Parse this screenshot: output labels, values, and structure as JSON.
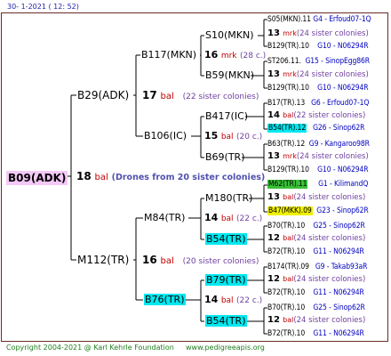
{
  "header": {
    "date": "30-   1-2021  ( 12:  52)"
  },
  "footer": {
    "copyright": "Copyright 2004-2021 @ Karl Kehrle Foundation",
    "site": "www.pedigreeapis.org"
  },
  "root": {
    "name": "B09(ADK)",
    "num": "18",
    "bal": "bal",
    "note": "(Drones from 20 sister colonies)"
  },
  "gen1": [
    {
      "name": "B29(ADK)",
      "num": "17",
      "bal": "bal",
      "note": "(22 sister colonies)"
    },
    {
      "name": "M112(TR)",
      "num": "16",
      "bal": "bal",
      "note": "(20 sister colonies)"
    }
  ],
  "gen2": [
    {
      "name": "B117(MKN)",
      "num": "16",
      "bal": "mrk",
      "note": "(28 c.)"
    },
    {
      "name": "B106(IC)",
      "num": "15",
      "bal": "bal",
      "note": "(20 c.)"
    },
    {
      "name": "M84(TR)",
      "num": "14",
      "bal": "bal",
      "note": "(22 c.)"
    },
    {
      "name": "B76(TR)",
      "num": "14",
      "bal": "bal",
      "note": "(22 c.)"
    }
  ],
  "gen3": [
    {
      "name": "S10(MKN)",
      "num": "13",
      "bal": "mrk",
      "note": "(24 sister colonies)"
    },
    {
      "name": "B59(MKN)",
      "num": "13",
      "bal": "mrk",
      "note": "(24 sister colonies)"
    },
    {
      "name": "B417(IC)",
      "num": "14",
      "bal": "bal",
      "note": "(22 sister colonies)"
    },
    {
      "name": "B69(TR)",
      "num": "13",
      "bal": "mrk",
      "note": "(24 sister colonies)"
    },
    {
      "name": "M180(TR)",
      "num": "13",
      "bal": "bal",
      "note": "(24 sister colonies)"
    },
    {
      "name": "B54(TR)",
      "num": "12",
      "bal": "bal",
      "note": "(24 sister colonies)"
    },
    {
      "name": "B79(TR)",
      "num": "12",
      "bal": "bal",
      "note": "(24 sister colonies)"
    },
    {
      "name": "B54(TR)",
      "num": "12",
      "bal": "bal",
      "note": "(24 sister colonies)"
    }
  ],
  "leaves": [
    {
      "left": "S05(MKN).11",
      "right": "G4 - Erfoud07-1Q"
    },
    {
      "left": "B129(TR).10",
      "right": "G10 - N06294R"
    },
    {
      "left": "ST206.11.",
      "right": "G15 - SinopEgg86R"
    },
    {
      "left": "B129(TR).10",
      "right": "G10 - N06294R"
    },
    {
      "left": "B17(TR).13",
      "right": "G6 - Erfoud07-1Q"
    },
    {
      "left": "B54(TR).12",
      "right": "G26 - Sinop62R"
    },
    {
      "left": "B63(TR).12",
      "right": "G9 - Kangaroo98R"
    },
    {
      "left": "B129(TR).10",
      "right": "G10 - N06294R"
    },
    {
      "left": "M62(TR).11",
      "right": "G1 - KilimandQ"
    },
    {
      "left": "B47(MKK).09",
      "right": "G23 - Sinop62R"
    },
    {
      "left": "B70(TR).10",
      "right": "G25 - Sinop62R"
    },
    {
      "left": "B72(TR).10",
      "right": "G11 - N06294R"
    },
    {
      "left": "B174(TR).09",
      "right": "G9 - Takab93aR"
    },
    {
      "left": "B72(TR).10",
      "right": "G11 - N06294R"
    },
    {
      "left": "B70(TR).10",
      "right": "G25 - Sinop62R"
    },
    {
      "left": "B72(TR).10",
      "right": "G11 - N06294R"
    }
  ],
  "colors": {
    "line": "#000000",
    "bal": "#c00000",
    "note": "#7040a0",
    "leaf_blue": "#0000c0",
    "cyan": "#00e8f0",
    "green": "#38c038",
    "yellow": "#f0f000",
    "pink": "#f4c8f8"
  }
}
